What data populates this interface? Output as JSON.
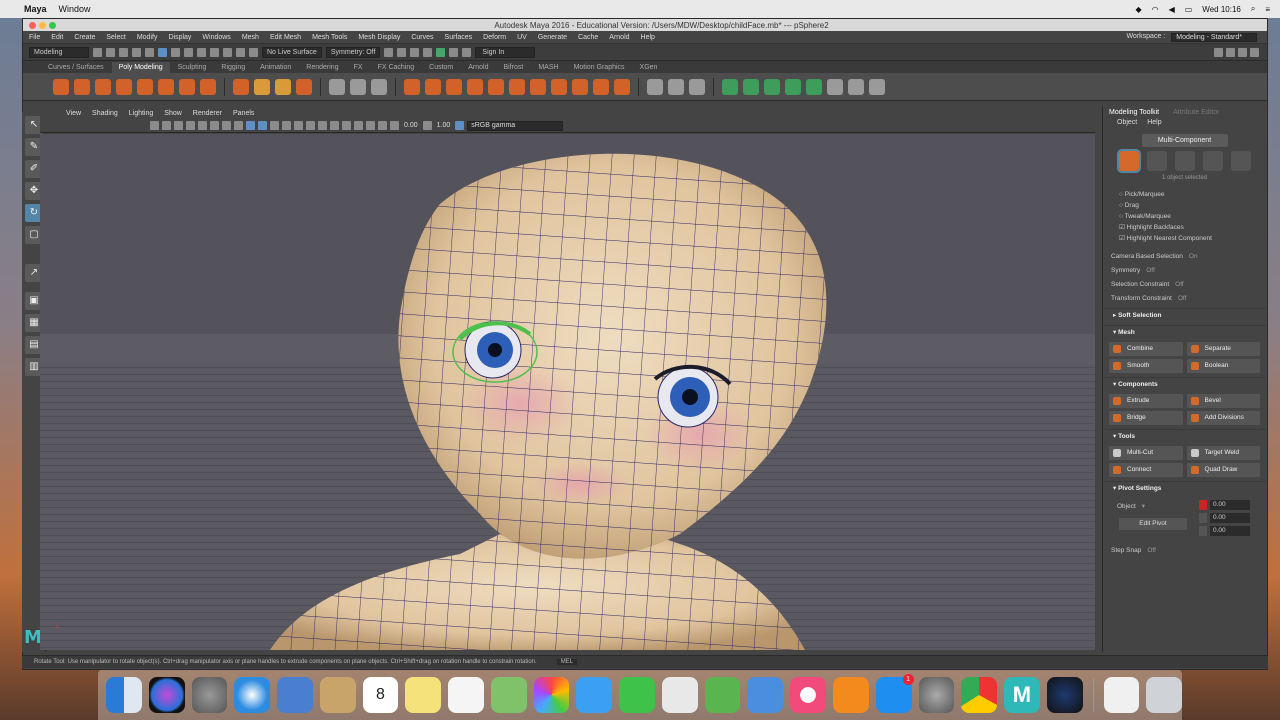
{
  "menubar": {
    "apple": "",
    "app_name": "Maya",
    "items": [
      "Window"
    ],
    "clock": "Wed 10:16"
  },
  "window": {
    "title": "Autodesk Maya 2016 - Educational Version: /Users/MDW/Desktop/childFace.mb* --- pSphere2"
  },
  "maya_menu": {
    "items": [
      "File",
      "Edit",
      "Create",
      "Select",
      "Modify",
      "Display",
      "Windows",
      "Mesh",
      "Edit Mesh",
      "Mesh Tools",
      "Mesh Display",
      "Curves",
      "Surfaces",
      "Deform",
      "UV",
      "Generate",
      "Cache",
      "Arnold",
      "Help"
    ],
    "workspace_label": "Workspace :",
    "workspace_value": "Modeling - Standard*"
  },
  "status_line": {
    "menu_set": "Modeling",
    "live_surface": "No Live Surface",
    "symmetry": "Symmetry: Off",
    "sign_in": "Sign In"
  },
  "shelf_tabs": [
    "Curves / Surfaces",
    "Poly Modeling",
    "Sculpting",
    "Rigging",
    "Animation",
    "Rendering",
    "FX",
    "FX Caching",
    "Custom",
    "Arnold",
    "Bifrost",
    "MASH",
    "Motion Graphics",
    "XGen"
  ],
  "shelf_tabs_active": 1,
  "viewport": {
    "menu": [
      "View",
      "Shading",
      "Lighting",
      "Show",
      "Renderer",
      "Panels"
    ],
    "num1": "0.00",
    "num2": "1.00",
    "camera": "sRGB gamma"
  },
  "help_line": {
    "text": "Rotate Tool: Use manipulator to rotate object(s). Ctrl+drag manipulator axis or plane handles to extrude components on plane objects. Ctrl+Shift+drag on rotation handle to constrain rotation.",
    "mel": "MEL"
  },
  "modeling_toolkit": {
    "tab1": "Modeling Toolkit",
    "tab2": "Attribute Editor",
    "submenu": [
      "Object",
      "Help"
    ],
    "multi_component": "Multi-Component",
    "selected_count": "1 object selected",
    "options": [
      "Pick/Marquee",
      "Drag",
      "Tweak/Marquee",
      "Highlight Backfaces",
      "Highlight Nearest Component"
    ],
    "rows": [
      {
        "label": "Camera Based Selection",
        "value": "On"
      },
      {
        "label": "Symmetry",
        "value": "Off"
      },
      {
        "label": "Selection Constraint",
        "value": "Off"
      },
      {
        "label": "Transform Constraint",
        "value": "Off"
      }
    ],
    "soft_selection": "Soft Selection",
    "sections": {
      "mesh": "Mesh",
      "components": "Components",
      "tools": "Tools",
      "pivot": "Pivot Settings"
    },
    "mesh_buttons": [
      "Combine",
      "Separate",
      "Smooth",
      "Boolean"
    ],
    "component_buttons": [
      "Extrude",
      "Bevel",
      "Bridge",
      "Add Divisions"
    ],
    "tool_buttons": [
      "Multi-Cut",
      "Target Weld",
      "Connect",
      "Quad Draw"
    ],
    "pivot": {
      "space": "Object",
      "edit_pivot": "Edit Pivot",
      "values": [
        "0.00",
        "0.00",
        "0.00"
      ],
      "step_snap_label": "Step Snap",
      "step_snap_value": "Off"
    }
  },
  "toolbox": {
    "logo": "M"
  },
  "dock": {
    "calendar_day": "8",
    "badge": "1"
  }
}
